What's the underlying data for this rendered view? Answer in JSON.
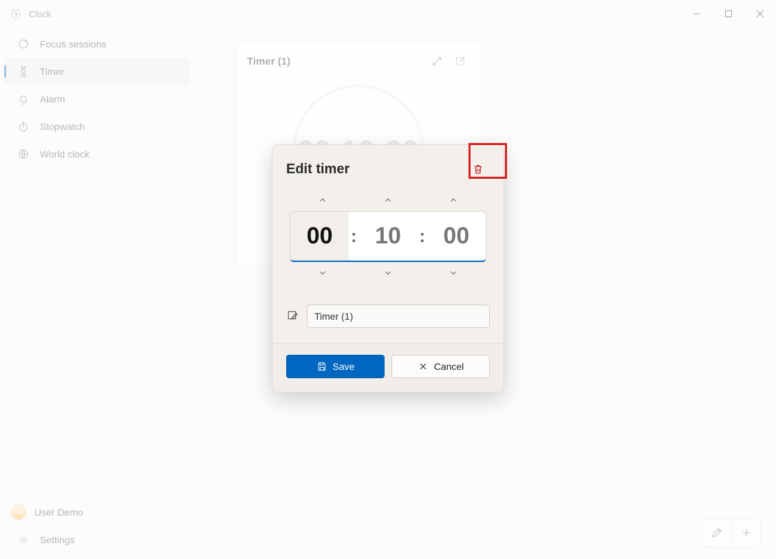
{
  "app": {
    "name": "Clock"
  },
  "sidebar": {
    "items": [
      {
        "label": "Focus sessions"
      },
      {
        "label": "Timer"
      },
      {
        "label": "Alarm"
      },
      {
        "label": "Stopwatch"
      },
      {
        "label": "World clock"
      }
    ],
    "user": "User Demo",
    "settings": "Settings"
  },
  "timer_card": {
    "title": "Timer (1)",
    "time": "00:10:00"
  },
  "modal": {
    "title": "Edit timer",
    "hours": "00",
    "minutes": "10",
    "seconds": "00",
    "name_value": "Timer (1)",
    "save": "Save",
    "cancel": "Cancel"
  }
}
